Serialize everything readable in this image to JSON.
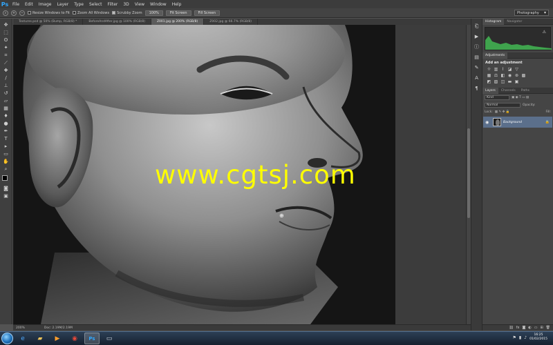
{
  "app": {
    "logo": "Ps"
  },
  "menu": [
    "File",
    "Edit",
    "Image",
    "Layer",
    "Type",
    "Select",
    "Filter",
    "3D",
    "View",
    "Window",
    "Help"
  ],
  "options": {
    "resize_windows": "Resize Windows to Fit",
    "zoom_all": "Zoom All Windows",
    "scrubby_zoom": "Scrubby Zoom",
    "btn_100": "100%",
    "btn_fit": "Fit Screen",
    "btn_fill": "Fill Screen",
    "workspace": "Photography"
  },
  "tabs": [
    "Textures.psd @ 50% (Bump, RGB/8) *",
    "BeforeAndAfter.jpg @ 100% (RGB/8)",
    "Z001.jpg @ 200% (RGB/8)",
    "Z002.jpg @ 66.7% (RGB/8)"
  ],
  "watermark": "www.cgtsj.com",
  "status": {
    "zoom": "200%",
    "doc": "Doc: 2.19M/2.19M"
  },
  "panels": {
    "histogram_tab": "Histogram",
    "navigator_tab": "Navigator",
    "adjustments_tab": "Adjustments",
    "add_adjustment": "Add an adjustment",
    "layers_tab": "Layers",
    "channels_tab": "Channels",
    "paths_tab": "Paths",
    "kind": "Kind",
    "blend_mode": "Normal",
    "opacity_label": "Opacity:",
    "lock_label": "Lock:",
    "fill_label": "Fill:",
    "layer_name": "Background"
  },
  "taskbar": {
    "time": "16:25",
    "date": "01/02/2015"
  },
  "colors": {
    "accent": "#31a8ff",
    "watermark": "#ffff00",
    "selected_layer": "#5b6f8b"
  }
}
